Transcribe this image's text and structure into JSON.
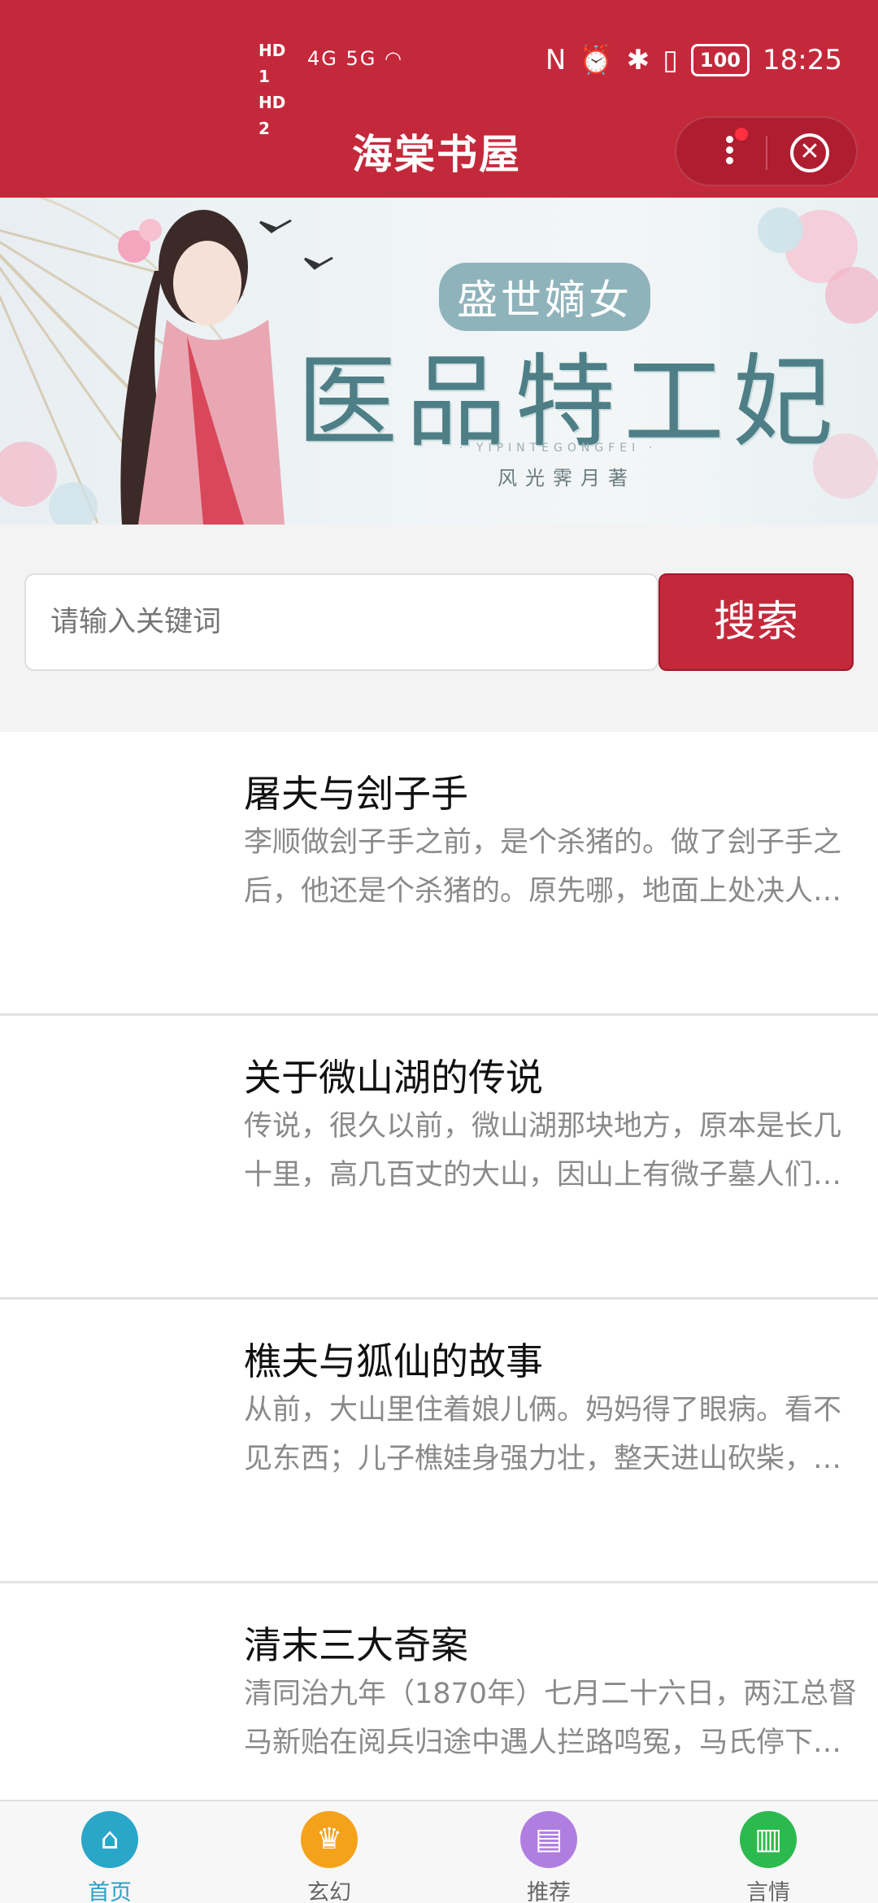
{
  "status_bar": {
    "time": "18:25",
    "hd_labels": "HD 1 HD 2",
    "network": "4G 5G",
    "battery": "100"
  },
  "header": {
    "title": "海棠书屋"
  },
  "banner": {
    "subtitle": "盛世嫡女",
    "main_title": "医品特工妃",
    "pinyin": "· YIPINTEGONGFEI ·",
    "author": "风光霁月著",
    "active_dot": 1,
    "dot_count": 1
  },
  "search": {
    "placeholder": "请输入关键词",
    "button_label": "搜索"
  },
  "stories": [
    {
      "title": "屠夫与刽子手",
      "summary": "李顺做刽子手之前，是个杀猪的。做了刽子手之后，他还是个杀猪的。原先哪，地面上处决人…"
    },
    {
      "title": "关于微山湖的传说",
      "summary": "传说，很久以前，微山湖那块地方，原本是长几十里，高几百丈的大山，因山上有微子墓人们…"
    },
    {
      "title": "樵夫与狐仙的故事",
      "summary": "从前，大山里住着娘儿俩。妈妈得了眼病。看不见东西；儿子樵娃身强力壮，整天进山砍柴，…"
    },
    {
      "title": "清末三大奇案",
      "summary": "清同治九年（1870年）七月二十六日，两江总督马新贻在阅兵归途中遇人拦路鸣冤，马氏停下…"
    }
  ],
  "tabbar": {
    "tabs": [
      {
        "label": "首页",
        "icon": "home-icon",
        "color": "#2aa6c9"
      },
      {
        "label": "玄幻",
        "icon": "trophy-icon",
        "color": "#f5a21b"
      },
      {
        "label": "推荐",
        "icon": "shop-icon",
        "color": "#b07ee0"
      },
      {
        "label": "言情",
        "icon": "book-icon",
        "color": "#2cba4f"
      }
    ],
    "active_index": 0
  },
  "colors": {
    "brand": "#c4293b",
    "active_tab": "#2a9fc5"
  }
}
